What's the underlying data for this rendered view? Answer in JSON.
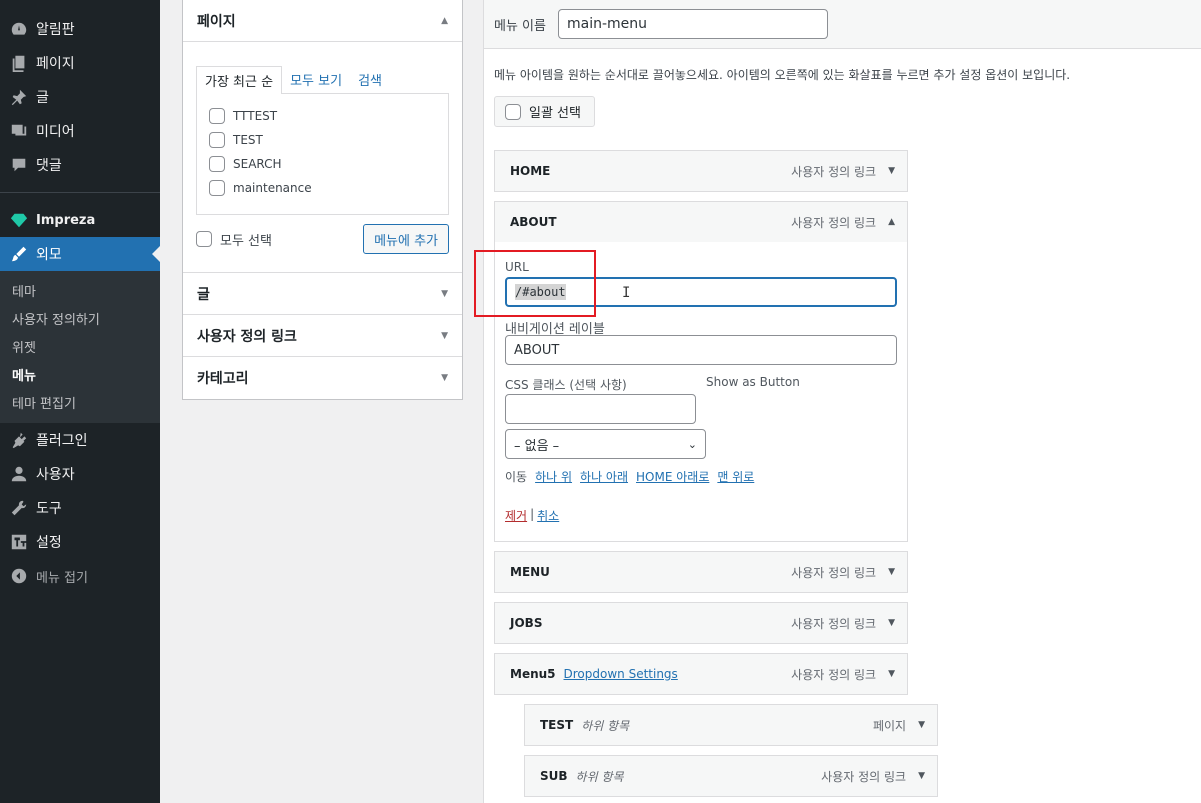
{
  "sidebar": {
    "items": [
      {
        "label": "알림판",
        "icon": "dashboard-icon"
      },
      {
        "label": "페이지",
        "icon": "pages-icon"
      },
      {
        "label": "글",
        "icon": "pin-icon"
      },
      {
        "label": "미디어",
        "icon": "media-icon"
      },
      {
        "label": "댓글",
        "icon": "comment-icon"
      }
    ],
    "impreza": "Impreza",
    "appearance": "외모",
    "submenu": [
      "테마",
      "사용자 정의하기",
      "위젯",
      "메뉴",
      "테마 편집기"
    ],
    "bottom_items": [
      {
        "label": "플러그인",
        "icon": "plugin-icon"
      },
      {
        "label": "사용자",
        "icon": "user-icon"
      },
      {
        "label": "도구",
        "icon": "wrench-icon"
      },
      {
        "label": "설정",
        "icon": "settings-icon"
      }
    ],
    "collapse": "메뉴 접기"
  },
  "left_panel": {
    "pages_title": "페이지",
    "tabs": [
      "가장 최근 순",
      "모두 보기",
      "검색"
    ],
    "pages": [
      "TTTEST",
      "TEST",
      "SEARCH",
      "maintenance"
    ],
    "select_all": "모두 선택",
    "add_button": "메뉴에 추가",
    "sections": [
      "글",
      "사용자 정의 링크",
      "카테고리"
    ]
  },
  "menu": {
    "name_label": "메뉴 이름",
    "name_value": "main-menu",
    "instructions": "메뉴 아이템을 원하는 순서대로 끌어놓으세요. 아이템의 오른쪽에 있는 화살표를 누르면 추가 설정 옵션이 보입니다.",
    "bulk_select": "일괄 선택",
    "items": {
      "home": {
        "title": "HOME",
        "type": "사용자 정의 링크"
      },
      "about": {
        "title": "ABOUT",
        "type": "사용자 정의 링크"
      },
      "menu": {
        "title": "MENU",
        "type": "사용자 정의 링크"
      },
      "jobs": {
        "title": "JOBS",
        "type": "사용자 정의 링크"
      },
      "menu5": {
        "title": "Menu5",
        "link": "Dropdown Settings",
        "type": "사용자 정의 링크"
      },
      "test": {
        "title": "TEST",
        "sub": "하위 항목",
        "type": "페이지"
      },
      "sub": {
        "title": "SUB",
        "sub": "하위 항목",
        "type": "사용자 정의 링크"
      }
    },
    "about_settings": {
      "url_label": "URL",
      "url_value": "/#about",
      "nav_label_label": "내비게이션 레이블",
      "nav_label_value": "ABOUT",
      "css_label": "CSS 클래스 (선택 사항)",
      "show_as_button": "Show as Button",
      "select_value": "– 없음 –",
      "move_label": "이동",
      "move_links": [
        "하나 위",
        "하나 아래",
        "HOME 아래로",
        "맨 위로"
      ],
      "remove": "제거",
      "separator": "|",
      "cancel": "취소"
    }
  },
  "colors": {
    "admin_bar": "#1d2327",
    "accent": "#2271b1",
    "highlight": "#e31b23"
  }
}
